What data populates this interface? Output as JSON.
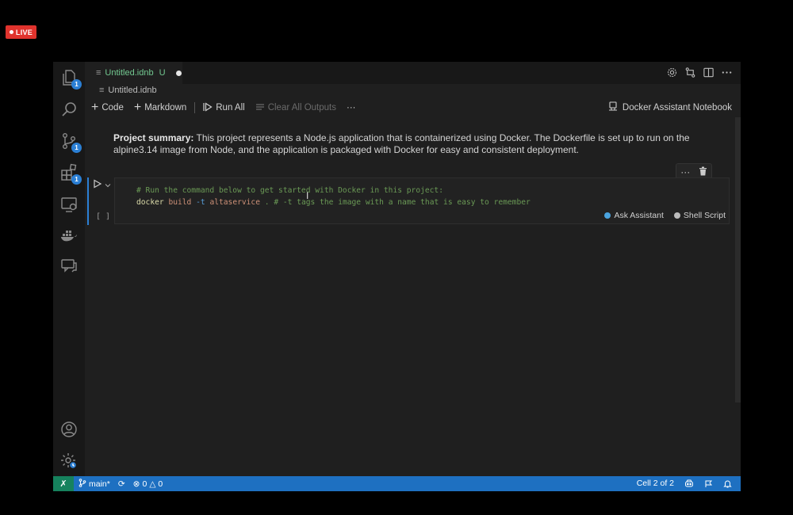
{
  "live_badge": {
    "label": "LIVE"
  },
  "activity_bar": {
    "items": [
      {
        "name": "explorer",
        "badge": "1"
      },
      {
        "name": "search",
        "badge": ""
      },
      {
        "name": "source-control",
        "badge": "1"
      },
      {
        "name": "extensions",
        "badge": "1"
      },
      {
        "name": "remote-explorer",
        "badge": ""
      },
      {
        "name": "docker",
        "badge": ""
      },
      {
        "name": "chat",
        "badge": ""
      }
    ],
    "bottom": [
      {
        "name": "accounts"
      },
      {
        "name": "manage"
      }
    ]
  },
  "tab": {
    "title": "Untitled.idnb",
    "status": "U"
  },
  "breadcrumb": {
    "file": "Untitled.idnb"
  },
  "toolbar": {
    "code_label": "Code",
    "markdown_label": "Markdown",
    "run_all_label": "Run All",
    "clear_outputs_label": "Clear All Outputs",
    "more_label": "···",
    "kernel_label": "Docker Assistant Notebook"
  },
  "markdown_cell": {
    "bold_prefix": "Project summary:",
    "text": " This project represents a Node.js application that is containerized using Docker. The Dockerfile is set up to run on the alpine3.14 image from Node, and the application is packaged with Docker for easy and consistent deployment."
  },
  "code_cell": {
    "exec_label": "[ ]",
    "comment_line": "# Run the command below to get started with Docker in this project:",
    "tokens": {
      "cmd": "docker",
      "sub": "build",
      "flag": "-t",
      "arg": "altaservice",
      "rest": " . # -t tags the image with a name that is easy to remember"
    },
    "ask_assistant_label": "Ask Assistant",
    "language_label": "Shell Script"
  },
  "status_bar": {
    "branch": "main*",
    "errors": "0",
    "warnings": "0",
    "cell_position": "Cell 2 of 2"
  },
  "colors": {
    "status_bar": "#1e70c1",
    "remote": "#16825d",
    "live": "#e0332d",
    "badge": "#2b7fd4"
  }
}
